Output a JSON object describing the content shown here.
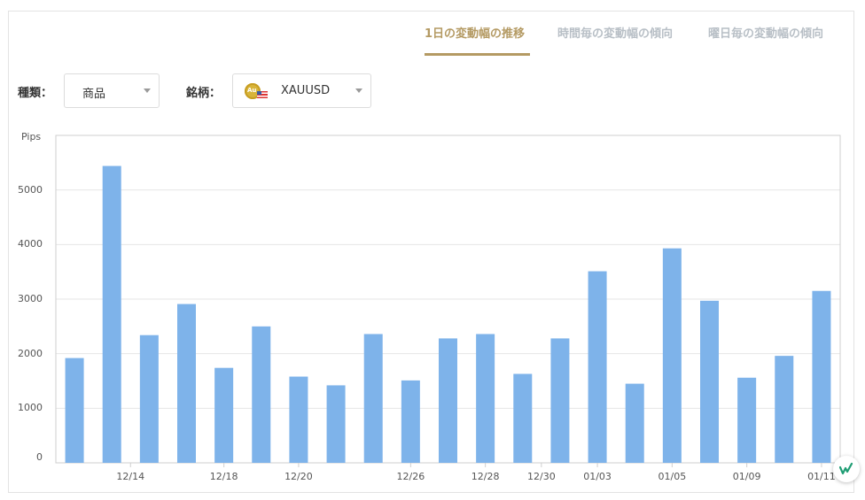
{
  "tabs": [
    {
      "label": "1日の変動幅の推移",
      "active": true
    },
    {
      "label": "時間毎の変動幅の傾向",
      "active": false
    },
    {
      "label": "曜日毎の変動幅の傾向",
      "active": false
    }
  ],
  "filters": {
    "type_label": "種類：",
    "type_value": "商品",
    "symbol_label": "銘柄：",
    "symbol_value": "XAUUSD",
    "symbol_icon_text": "Au"
  },
  "colors": {
    "accent": "#b49a63",
    "bar": "#7eb3ea",
    "tab_inactive": "#b8bfc6"
  },
  "chart_data": {
    "type": "bar",
    "ylabel": "Pips",
    "ylim": [
      0,
      6000
    ],
    "yticks": [
      0,
      1000,
      2000,
      3000,
      4000,
      5000
    ],
    "grid": true,
    "values": [
      1920,
      5440,
      2340,
      2910,
      1740,
      2500,
      1580,
      1420,
      2360,
      1510,
      2280,
      2360,
      1630,
      2280,
      3510,
      1450,
      3930,
      2970,
      1560,
      1960,
      3150
    ],
    "xtick_labels": [
      {
        "bar_index": 1.5,
        "label": "12/14"
      },
      {
        "bar_index": 4,
        "label": "12/18"
      },
      {
        "bar_index": 6,
        "label": "12/20"
      },
      {
        "bar_index": 9,
        "label": "12/26"
      },
      {
        "bar_index": 11,
        "label": "12/28"
      },
      {
        "bar_index": 12.5,
        "label": "12/30"
      },
      {
        "bar_index": 14,
        "label": "01/03"
      },
      {
        "bar_index": 16,
        "label": "01/05"
      },
      {
        "bar_index": 18,
        "label": "01/09"
      },
      {
        "bar_index": 20,
        "label": "01/11"
      }
    ]
  }
}
